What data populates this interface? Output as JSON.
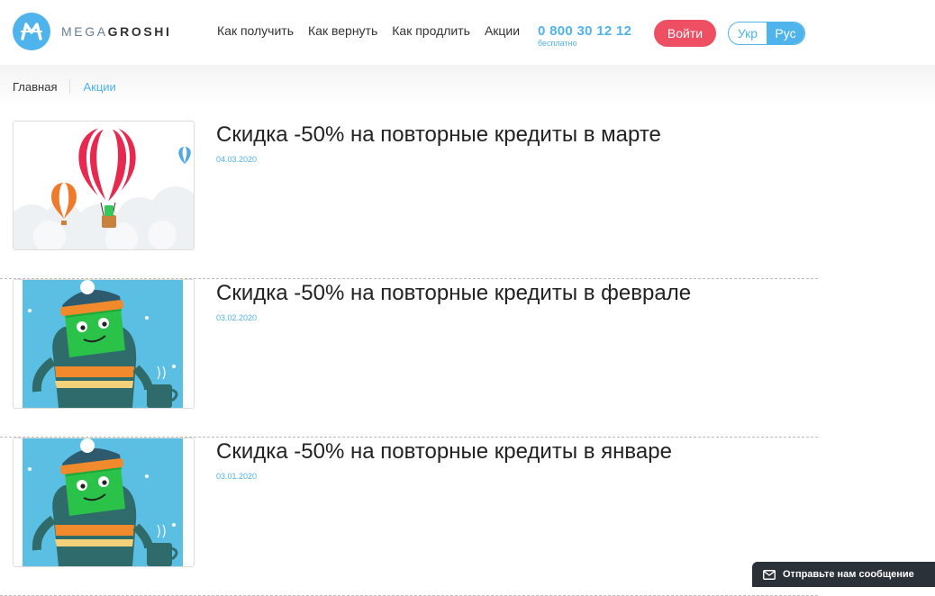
{
  "header": {
    "logo": {
      "text_light": "MEGA",
      "text_bold": "GROSHI",
      "icon": "logo-m-icon"
    },
    "nav": [
      {
        "label": "Как получить"
      },
      {
        "label": "Как вернуть"
      },
      {
        "label": "Как продлить"
      },
      {
        "label": "Акции"
      }
    ],
    "phone": {
      "number": "0 800 30 12 12",
      "note": "бесплатно"
    },
    "login_label": "Войти",
    "languages": [
      {
        "label": "Укр",
        "active": false
      },
      {
        "label": "Рус",
        "active": true
      }
    ]
  },
  "breadcrumb": {
    "home": "Главная",
    "current": "Акции"
  },
  "promos": [
    {
      "title": "Скидка -50% на повторные кредиты в марте",
      "date": "04.03.2020",
      "image": "hot-air-balloons"
    },
    {
      "title": "Скидка -50% на повторные кредиты в феврале",
      "date": "03.02.2020",
      "image": "mascot-winter-sweater"
    },
    {
      "title": "Скидка -50% на повторные кредиты в январе",
      "date": "03.01.2020",
      "image": "mascot-winter-sweater"
    }
  ],
  "chat": {
    "label": "Отправьте нам сообщение",
    "icon": "envelope-icon"
  },
  "colors": {
    "accent": "#4fb3ec",
    "login": "#ef4f63",
    "chat_bg": "#2b3138"
  }
}
